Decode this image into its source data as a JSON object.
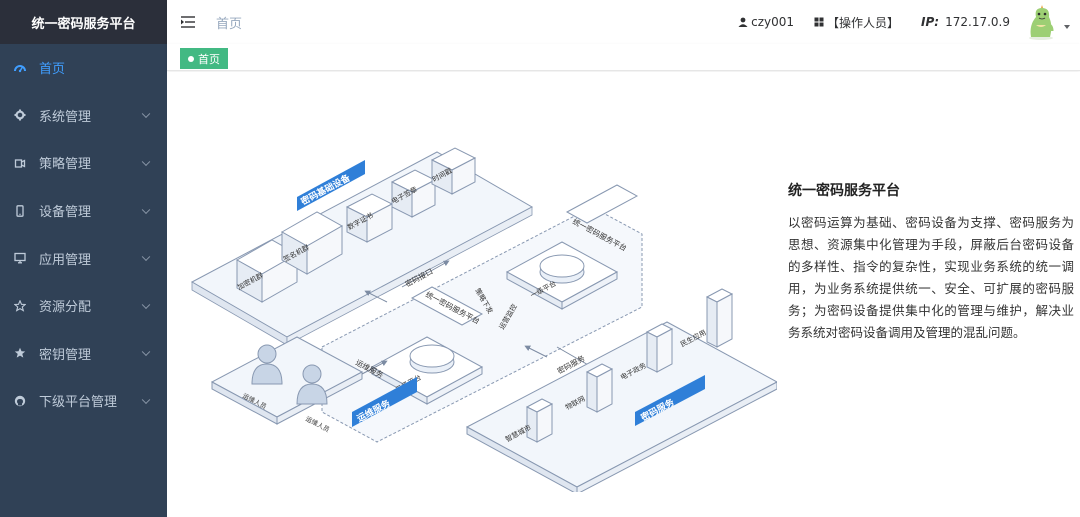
{
  "sidebar": {
    "brand": "统一密码服务平台",
    "items": [
      {
        "label": "首页",
        "icon": "dashboard-icon",
        "active": true
      },
      {
        "label": "系统管理",
        "icon": "gear-icon"
      },
      {
        "label": "策略管理",
        "icon": "strategy-icon"
      },
      {
        "label": "设备管理",
        "icon": "phone-icon"
      },
      {
        "label": "应用管理",
        "icon": "monitor-icon"
      },
      {
        "label": "资源分配",
        "icon": "star-outline-icon"
      },
      {
        "label": "密钥管理",
        "icon": "star-icon"
      },
      {
        "label": "下级平台管理",
        "icon": "github-icon"
      }
    ]
  },
  "header": {
    "breadcrumb": "首页",
    "user": "czy001",
    "role": "【操作人员】",
    "ip_label": "IP:",
    "ip_value": "172.17.0.9"
  },
  "tags": {
    "active_tag": "首页"
  },
  "main": {
    "title": "统一密码服务平台",
    "description": "以密码运算为基础、密码设备为支撑、密码服务为思想、资源集中化管理为手段，屏蔽后台密码设备的多样性、指令的复杂性，实现业务系统的统一调用，为业务系统提供统一、安全、可扩展的密码服务；为密码设备提供集中化的管理与维护，解决业务系统对密码设备调用及管理的混乱问题。",
    "illustration": {
      "label_base_devices": "密码基础设备",
      "device_encrypt": "加密机群",
      "device_sign": "签名机群",
      "device_cert": "数字证书",
      "device_esign": "电子签章",
      "device_timestamp": "时间戳",
      "label_crypto_api": "密码接口",
      "label_policy_issue": "策略下发",
      "label_config_monitor": "运营监控",
      "label_platform_top": "统一密码服务平台",
      "label_level1": "一级平台",
      "label_platform_mid": "统一密码服务平台",
      "label_level2": "二级平台",
      "label_crypto_service": "密码服务",
      "label_ops_service": "运维服务",
      "label_ops_service_2": "运维服务",
      "ops_person_1": "运维人员",
      "ops_person_2": "运维人员",
      "label_crypto_service_2": "密码服务",
      "app_smart_city": "智慧城市",
      "app_iot": "物联网",
      "app_egov": "电子政务",
      "app_livelihood": "民生应用"
    }
  }
}
